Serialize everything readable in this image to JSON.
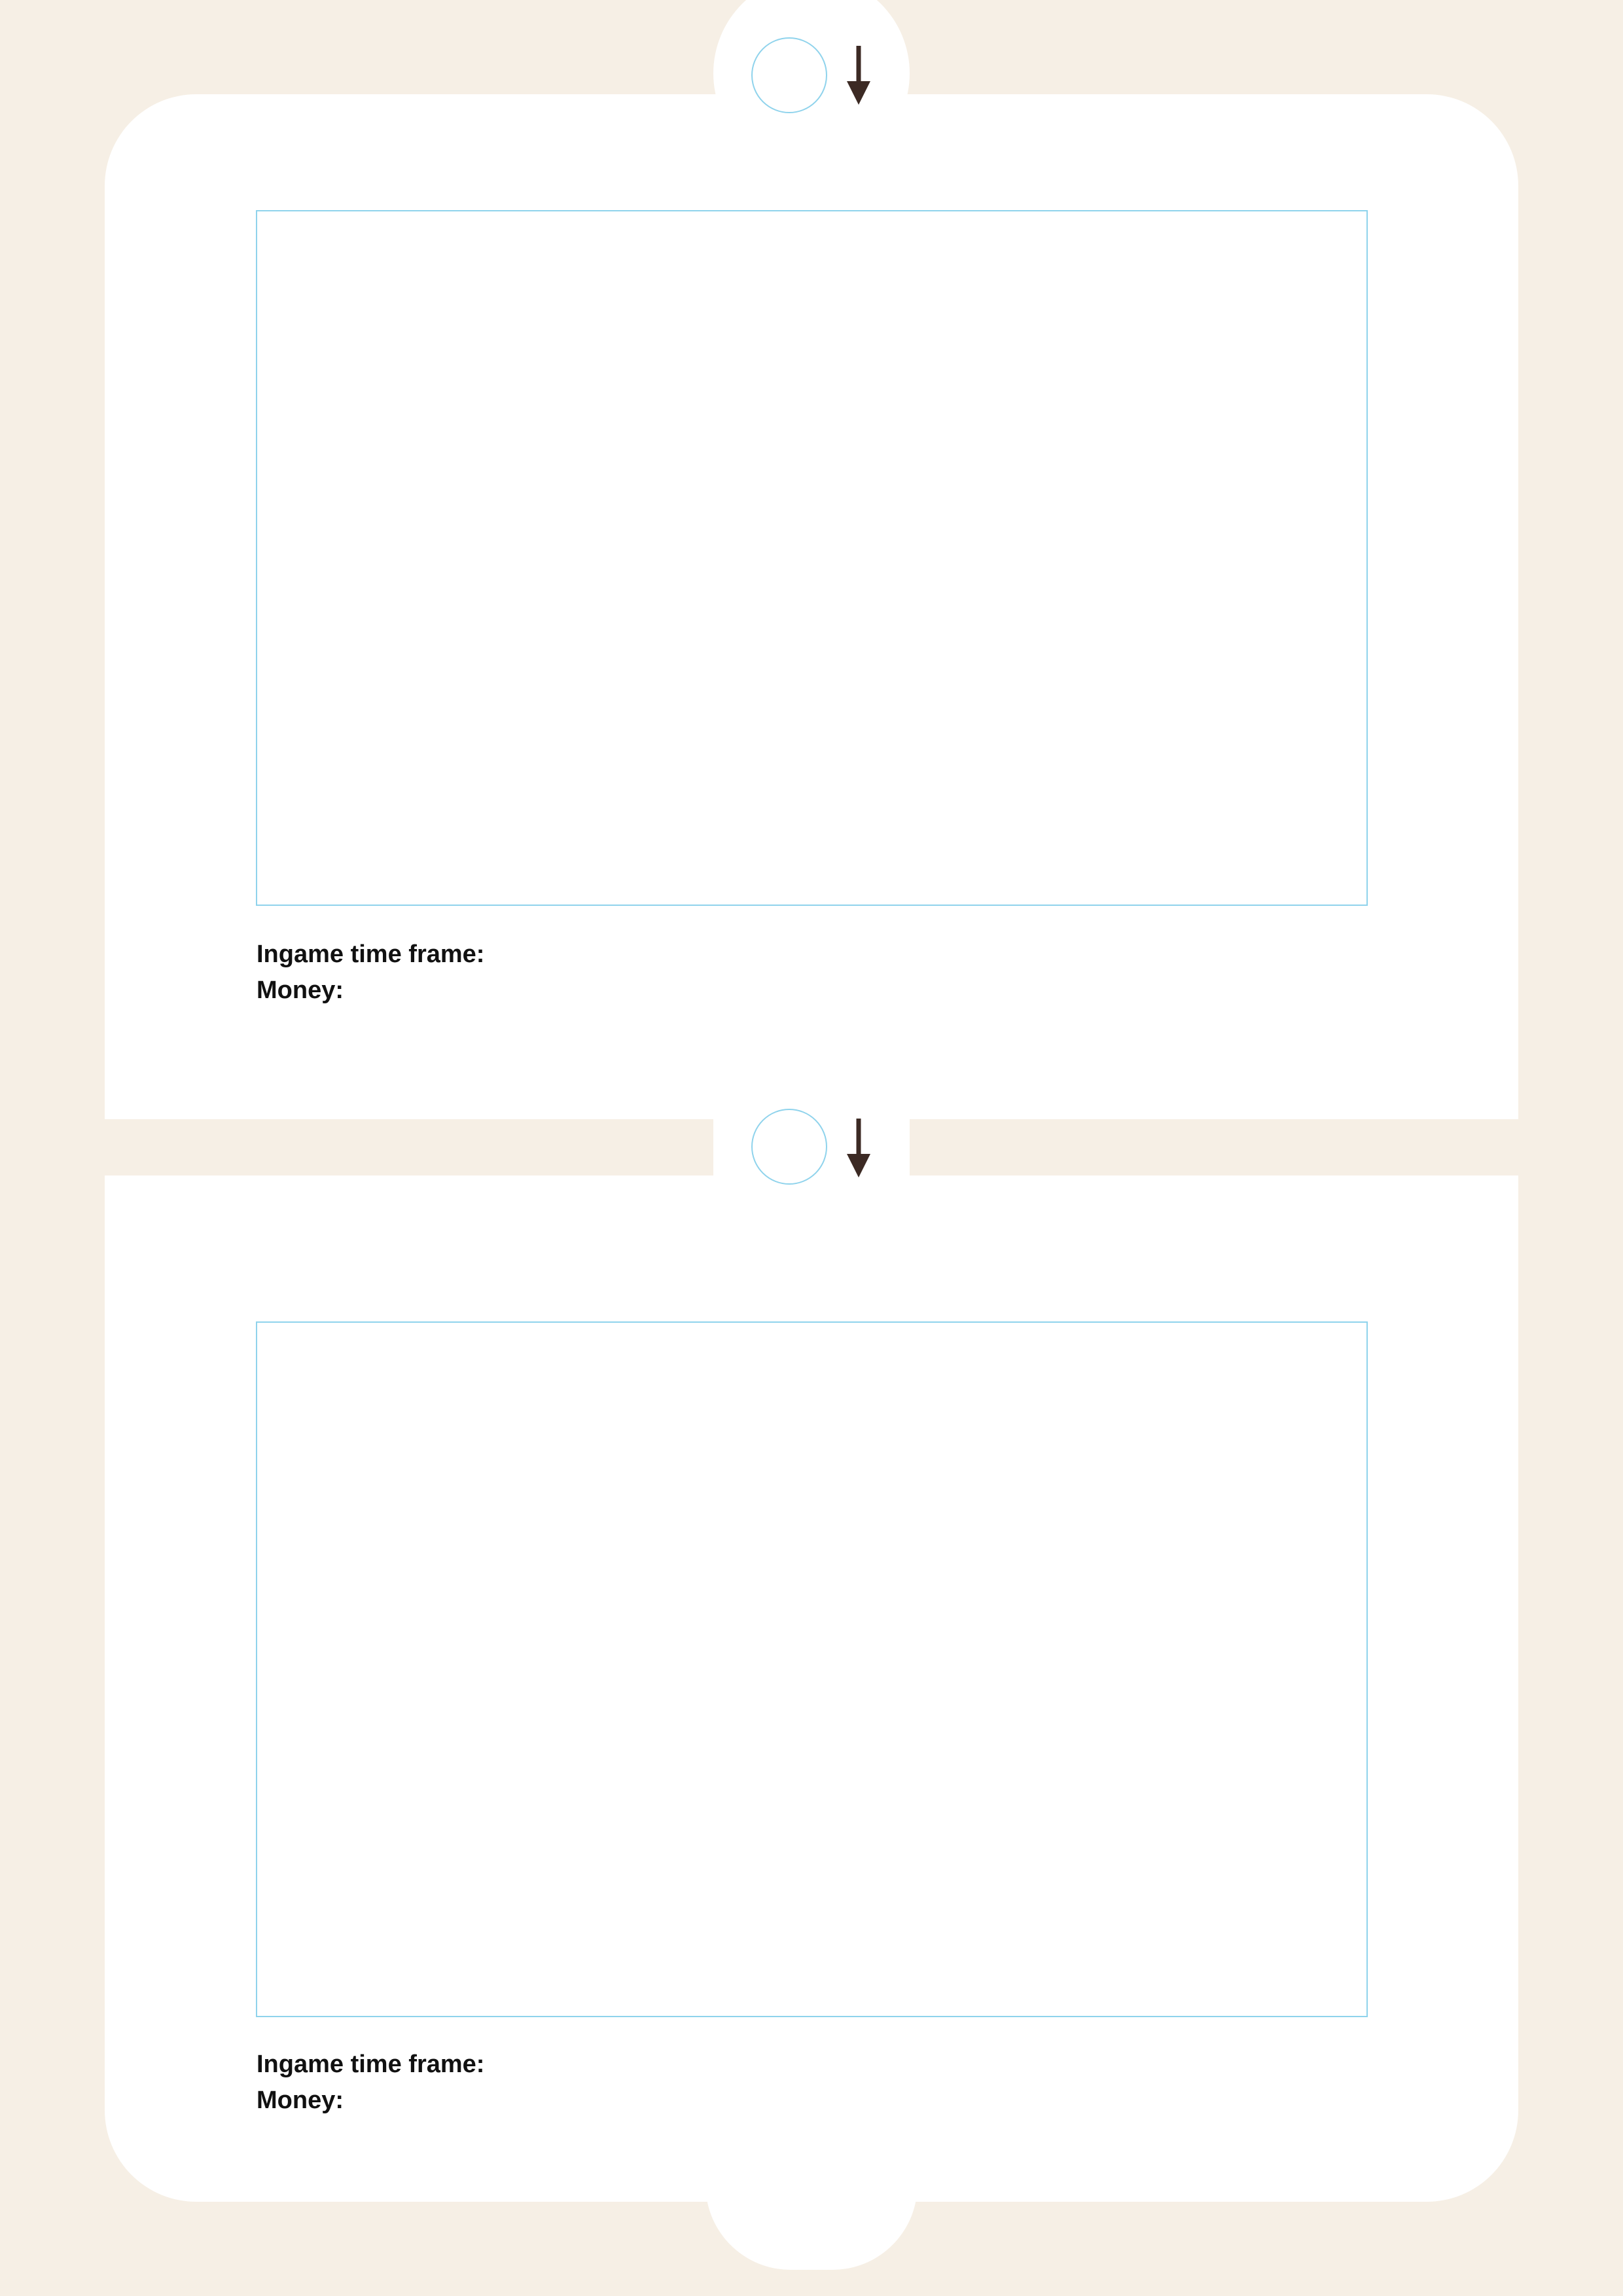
{
  "colors": {
    "background": "#f6efe5",
    "card": "#ffffff",
    "frame_border": "#8fd3ec",
    "arrow": "#3c2a24",
    "text": "#111111"
  },
  "icons": {
    "marker": "empty-circle",
    "arrow": "arrow-down"
  },
  "panels": [
    {
      "time_label": "Ingame time frame:",
      "money_label": "Money:"
    },
    {
      "time_label": "Ingame time frame:",
      "money_label": "Money:"
    }
  ]
}
